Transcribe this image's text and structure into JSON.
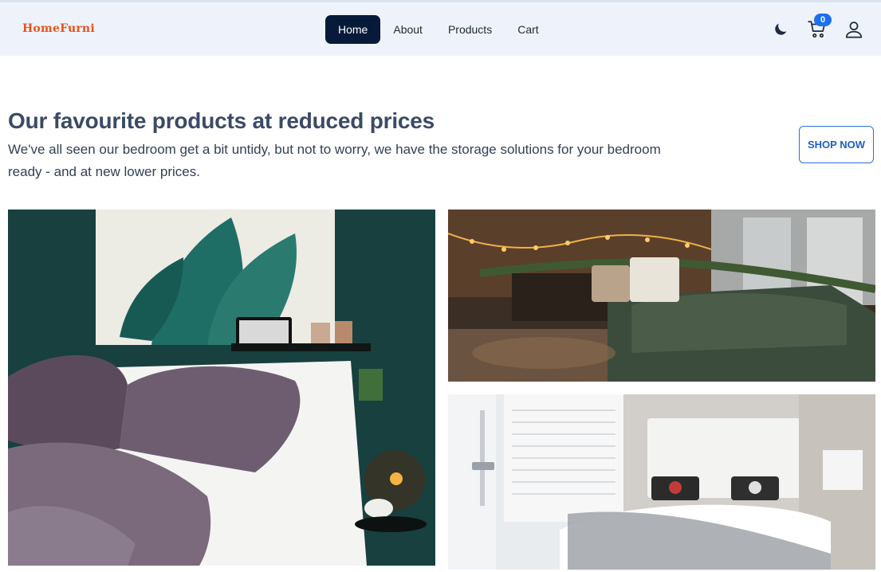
{
  "brand": {
    "logo_text": "HomeFurni",
    "accent": "#e8521b"
  },
  "nav": {
    "links": [
      {
        "label": "Home",
        "active": true
      },
      {
        "label": "About",
        "active": false
      },
      {
        "label": "Products",
        "active": false
      },
      {
        "label": "Cart",
        "active": false
      }
    ],
    "active_color": "#071a3a"
  },
  "header_icons": {
    "theme_toggle_icon": "moon-icon",
    "cart_icon": "cart-icon",
    "cart_count": "0",
    "user_icon": "user-icon",
    "badge_color": "#1d6ff2"
  },
  "hero": {
    "title": "Our favourite products at reduced prices",
    "description": "We've all seen our bedroom get a bit untidy, but not to worry, we have the storage solutions for your bedroom ready - and at new lower prices.",
    "cta_label": "SHOP NOW"
  },
  "gallery": {
    "images": [
      {
        "name": "bedroom-photo-dark-green-wall"
      },
      {
        "name": "bedroom-photo-string-lights"
      },
      {
        "name": "bedroom-photo-white-room"
      }
    ]
  }
}
